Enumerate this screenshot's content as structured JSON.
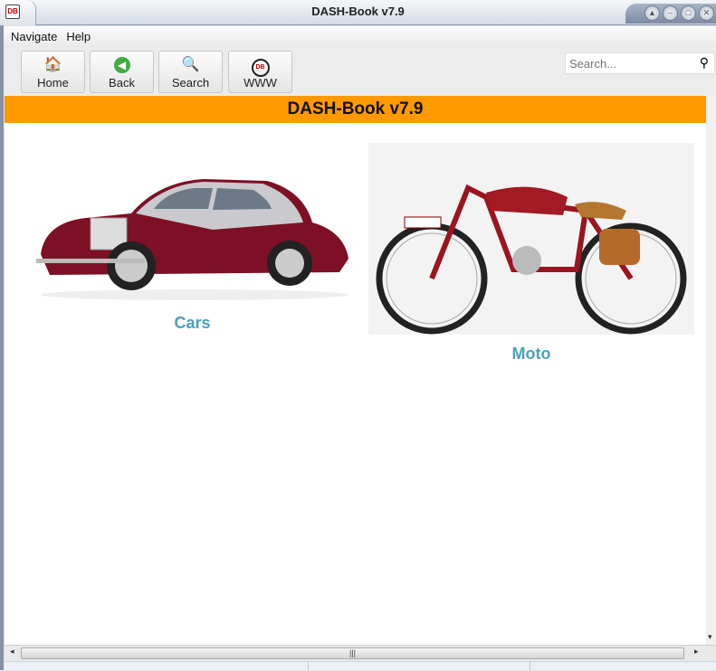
{
  "window": {
    "title": "DASH-Book v7.9",
    "app_icon": "dash-logo-icon",
    "controls": [
      "up",
      "minimize",
      "maximize",
      "close"
    ]
  },
  "menu": [
    "Navigate",
    "Help"
  ],
  "toolbar": {
    "buttons": [
      {
        "label": "Home",
        "icon": "home-icon"
      },
      {
        "label": "Back",
        "icon": "back-arrow-icon"
      },
      {
        "label": "Search",
        "icon": "magnifier-icon"
      },
      {
        "label": "WWW",
        "icon": "dash-logo-icon"
      }
    ]
  },
  "search": {
    "placeholder": "Search...",
    "value": ""
  },
  "banner": {
    "title": "DASH-Book v7.9"
  },
  "categories": [
    {
      "label": "Cars",
      "image": "classic-car"
    },
    {
      "label": "Moto",
      "image": "vintage-motorcycle"
    }
  ],
  "colors": {
    "banner": "#ff9900",
    "link": "#4aa3b8"
  }
}
